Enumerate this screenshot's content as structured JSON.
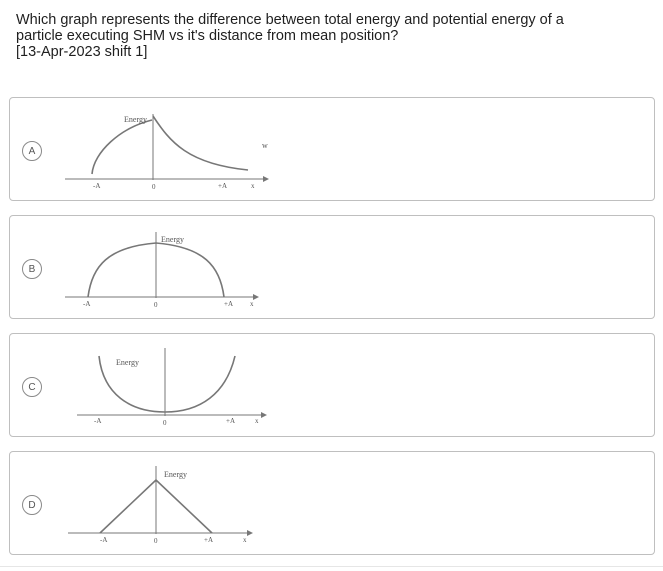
{
  "question": {
    "line1": "Which graph represents the difference between total energy and potential energy of a",
    "line2": "particle executing SHM vs it's distance from mean position?",
    "line3": "[13-Apr-2023 shift 1]"
  },
  "options": [
    {
      "letter": "A",
      "ylabel": "Energy",
      "x_neg": "-A",
      "x_zero": "0",
      "x_pos": "+A",
      "x_axis": "x",
      "extra": "w"
    },
    {
      "letter": "B",
      "ylabel": "Energy",
      "x_neg": "-A",
      "x_zero": "0",
      "x_pos": "+A",
      "x_axis": "x"
    },
    {
      "letter": "C",
      "ylabel": "Energy",
      "x_neg": "-A",
      "x_zero": "0",
      "x_pos": "+A",
      "x_axis": "x"
    },
    {
      "letter": "D",
      "ylabel": "Energy",
      "x_neg": "-A",
      "x_zero": "0",
      "x_pos": "+A",
      "x_axis": "x"
    }
  ]
}
